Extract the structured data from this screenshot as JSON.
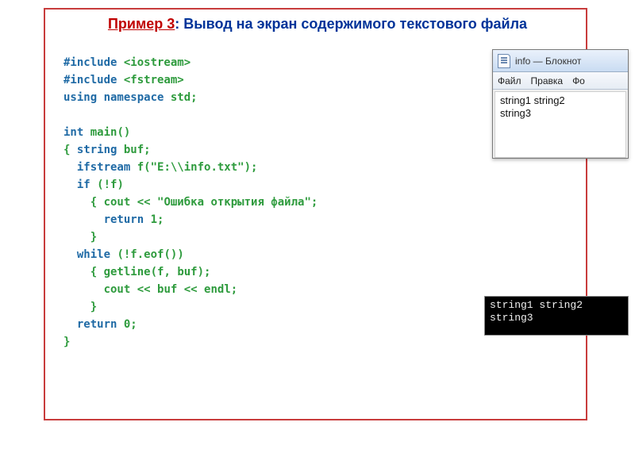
{
  "title": {
    "label": "Пример 3",
    "sep": ": ",
    "text": "Вывод на экран содержимого текстового файла"
  },
  "code": {
    "line1_a": "#include ",
    "line1_b": "<iostream>",
    "line2_a": "#include ",
    "line2_b": "<fstream>",
    "line3_a": "using namespace ",
    "line3_b": "std",
    "line3_c": ";",
    "blank1": "",
    "line4_a": "int ",
    "line4_b": "main",
    "line4_c": "()",
    "line5_a": "{ ",
    "line5_b": "string ",
    "line5_c": "buf",
    "line5_d": ";",
    "line6_a": "  ",
    "line6_b": "ifstream ",
    "line6_c": "f",
    "line6_d": "(",
    "line6_e": "\"E:\\\\info.txt\"",
    "line6_f": ");",
    "line7_a": "  ",
    "line7_b": "if ",
    "line7_c": "(!",
    "line7_d": "f",
    "line7_e": ")",
    "line8_a": "    { ",
    "line8_b": "cout",
    "line8_c": " << ",
    "line8_d": "\"Ошибка открытия файла\"",
    "line8_e": ";",
    "line9_a": "      ",
    "line9_b": "return ",
    "line9_c": "1;",
    "line10": "    }",
    "line11_a": "  ",
    "line11_b": "while ",
    "line11_c": "(!",
    "line11_d": "f",
    "line11_e": ".",
    "line11_f": "eof",
    "line11_g": "())",
    "line12_a": "    { ",
    "line12_b": "getline",
    "line12_c": "(",
    "line12_d": "f",
    "line12_e": ", ",
    "line12_f": "buf",
    "line12_g": ");",
    "line13_a": "      ",
    "line13_b": "cout",
    "line13_c": " << ",
    "line13_d": "buf",
    "line13_e": " << ",
    "line13_f": "endl",
    "line13_g": ";",
    "line14": "    }",
    "line15_a": "  ",
    "line15_b": "return ",
    "line15_c": "0;",
    "line16": "}"
  },
  "notepad": {
    "title": "info — Блокнот",
    "menu": {
      "file": "Файл",
      "edit": "Правка",
      "format_partial": "Фо"
    },
    "content": "string1 string2\nstring3"
  },
  "console": {
    "content": "string1 string2\nstring3"
  }
}
